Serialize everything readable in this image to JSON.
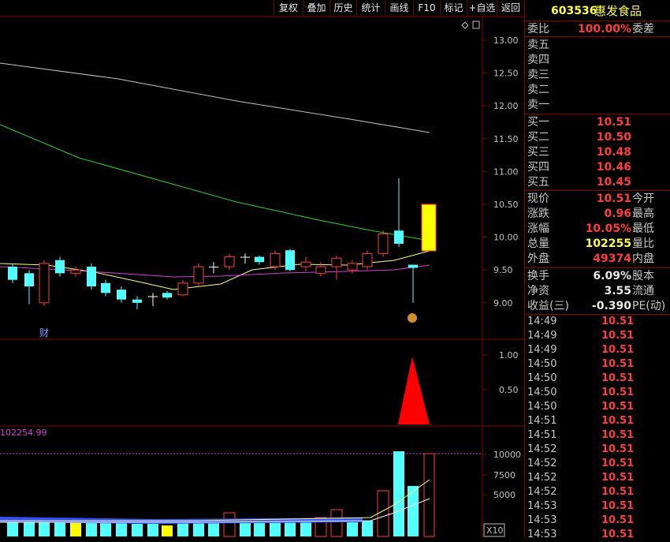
{
  "toolbar": [
    {
      "label": "复权",
      "name": "fuquan-button"
    },
    {
      "label": "叠加",
      "name": "overlay-button"
    },
    {
      "label": "历史",
      "name": "history-button"
    },
    {
      "label": "统计",
      "name": "stats-button"
    },
    {
      "label": "画线",
      "name": "draw-line-button"
    },
    {
      "label": "F10",
      "name": "f10-button"
    },
    {
      "label": "标记",
      "name": "mark-button"
    },
    {
      "label": "+自选",
      "name": "add-watchlist-button"
    },
    {
      "label": "返回",
      "name": "back-button"
    }
  ],
  "stock": {
    "code": "603536",
    "name": "惠发食品"
  },
  "quote": {
    "weibi_label": "委比",
    "weibi_value": "100.00%",
    "weicha_label": "委差",
    "sell": [
      "卖五",
      "卖四",
      "卖三",
      "卖二",
      "卖一"
    ],
    "buy": [
      {
        "label": "买一",
        "price": "10.51"
      },
      {
        "label": "买二",
        "price": "10.50"
      },
      {
        "label": "买三",
        "price": "10.48"
      },
      {
        "label": "买四",
        "price": "10.46"
      },
      {
        "label": "买五",
        "price": "10.45"
      }
    ],
    "stats": [
      {
        "label": "现价",
        "value": "10.51",
        "right": "今开",
        "color": "red"
      },
      {
        "label": "涨跌",
        "value": "0.96",
        "right": "最高",
        "color": "red"
      },
      {
        "label": "涨幅",
        "value": "10.05%",
        "right": "最低",
        "color": "red"
      },
      {
        "label": "总量",
        "value": "102255",
        "right": "量比",
        "color": "yellow"
      },
      {
        "label": "外盘",
        "value": "49374",
        "right": "内盘",
        "color": "red"
      }
    ],
    "stats2": [
      {
        "label": "换手",
        "value": "6.09%",
        "right": "股本",
        "color": "white"
      },
      {
        "label": "净资",
        "value": "3.55",
        "right": "流通",
        "color": "white"
      },
      {
        "label": "收益(三)",
        "value": "-0.390",
        "right": "PE(动)",
        "color": "white"
      }
    ]
  },
  "ticks": [
    {
      "time": "14:49",
      "price": "10.51"
    },
    {
      "time": "14:49",
      "price": "10.51"
    },
    {
      "time": "14:49",
      "price": "10.51"
    },
    {
      "time": "14:50",
      "price": "10.51"
    },
    {
      "time": "14:50",
      "price": "10.51"
    },
    {
      "time": "14:50",
      "price": "10.51"
    },
    {
      "time": "14:50",
      "price": "10.51"
    },
    {
      "time": "14:51",
      "price": "10.51"
    },
    {
      "time": "14:51",
      "price": "10.51"
    },
    {
      "time": "14:52",
      "price": "10.51"
    },
    {
      "time": "14:52",
      "price": "10.51"
    },
    {
      "time": "14:52",
      "price": "10.51"
    },
    {
      "time": "14:52",
      "price": "10.51"
    },
    {
      "time": "14:53",
      "price": "10.51"
    },
    {
      "time": "14:53",
      "price": "10.51"
    },
    {
      "time": "14:53",
      "price": "10.51"
    }
  ],
  "chart": {
    "price_ticks": [
      "13.00",
      "12.50",
      "12.00",
      "11.50",
      "11.00",
      "10.50",
      "10.00",
      "9.50",
      "9.00"
    ],
    "ind_ticks": [
      "1.00",
      "0.50"
    ],
    "vol_ticks": [
      "10000",
      "7500",
      "5000"
    ],
    "vol_max_label": "102254.99",
    "cai_label": "财",
    "x10_label": "X10",
    "colors": {
      "up": "#ff3c3c",
      "down": "#54ffff",
      "ma_long": "#c0c0c0",
      "ma_mid": "#30d030",
      "ma_short": "#ffff80",
      "ma_violet": "#d040d0",
      "limit": "#ffff00"
    }
  }
}
